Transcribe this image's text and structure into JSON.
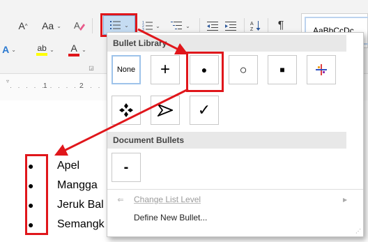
{
  "ribbon": {
    "font_size_label": "Aa",
    "font_color_label": "A",
    "styles_preview": "AaBbCcDc"
  },
  "ruler": {
    "marks": [
      "1",
      "2"
    ]
  },
  "document": {
    "items": [
      "Apel",
      "Mangga",
      "Jeruk Bal",
      "Semangk"
    ]
  },
  "bullets_menu": {
    "library_title": "Bullet Library",
    "none_label": "None",
    "document_title": "Document Bullets",
    "change_level_label": "Change List Level",
    "define_label": "Define New Bullet..."
  },
  "colors": {
    "highlight_red": "#e0161b",
    "selection_blue": "#c5dcf2"
  }
}
